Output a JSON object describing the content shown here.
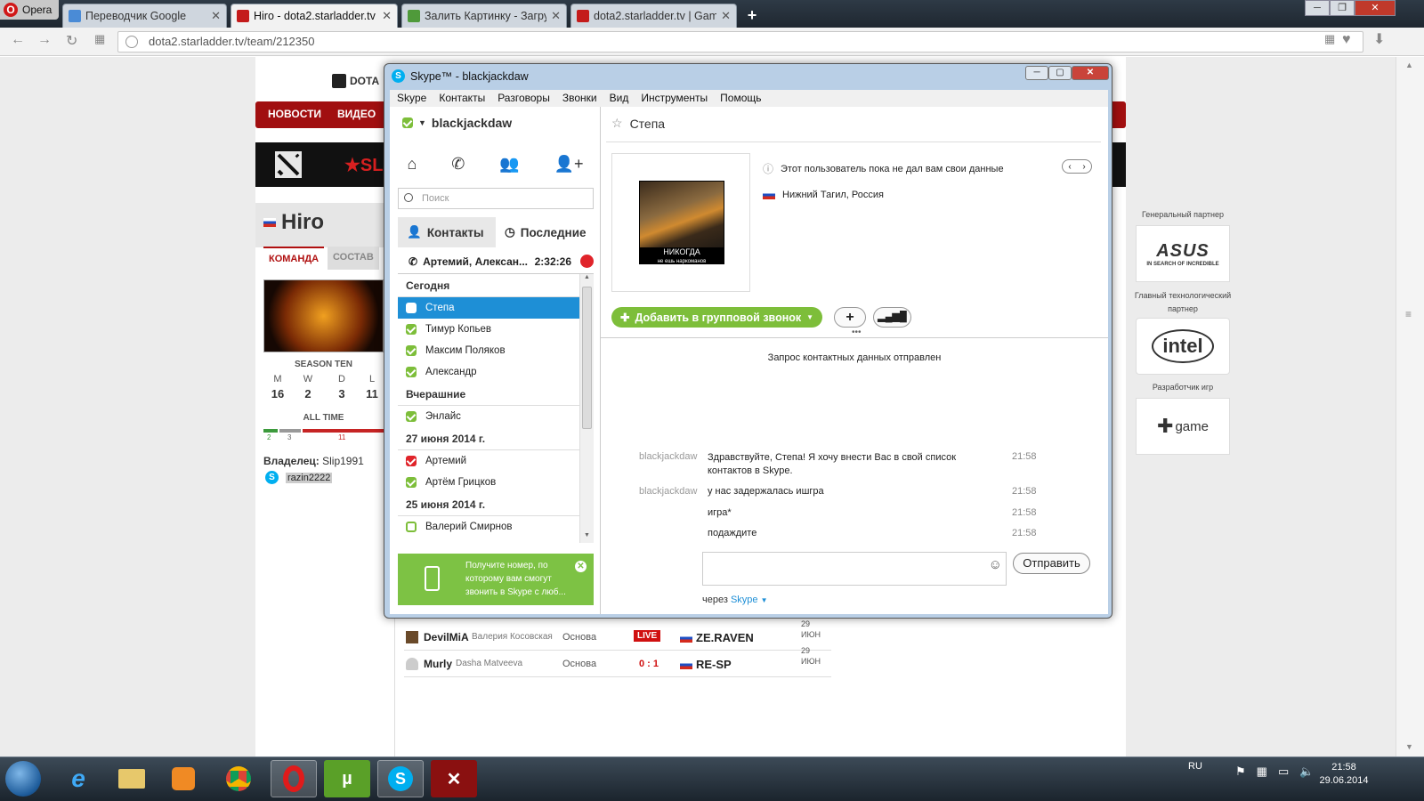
{
  "browser": {
    "opera_label": "Opera",
    "tabs": [
      {
        "title": "Переводчик Google",
        "favicon_color": "#4a8bd6"
      },
      {
        "title": "Hiro - dota2.starladder.tv",
        "favicon_color": "#c41b1b"
      },
      {
        "title": "Залить Картинку - Загруз",
        "favicon_color": "#4f9a3a"
      },
      {
        "title": "dota2.starladder.tv | Game",
        "favicon_color": "#c41b1b"
      }
    ],
    "new_tab_label": "+",
    "url": "dota2.starladder.tv/team/212350"
  },
  "site": {
    "logo_text": "DOTA",
    "nav": [
      "НОВОСТИ",
      "ВИДЕО"
    ],
    "team_name": "Hiro",
    "profile_tabs": [
      "КОМАНДА",
      "СОСТАВ"
    ],
    "season_label": "SEASON TEN",
    "stats": [
      {
        "label": "M",
        "value": "16"
      },
      {
        "label": "W",
        "value": "2"
      },
      {
        "label": "D",
        "value": "3"
      },
      {
        "label": "L",
        "value": "11"
      }
    ],
    "alltime_label": "ALL TIME",
    "alltime_values": [
      "2",
      "3",
      "11"
    ],
    "owner_label": "Владелец:",
    "owner_name": "Slip1991",
    "skype_name": "razin2222",
    "matches": [
      {
        "player": "DevilMiA",
        "real_name": "Валерия Косовская",
        "role": "Основа",
        "score": "LIVE",
        "opponent": "ZE.RAVEN",
        "date_day": "29",
        "date_mon": "ИЮН"
      },
      {
        "player": "Murly",
        "real_name": "Dasha Matveeva",
        "role": "Основа",
        "score": "0 : 1",
        "opponent": "RE-SP",
        "date_day": "29",
        "date_mon": "ИЮН"
      }
    ],
    "sponsors": {
      "general_label": "Генеральный партнер",
      "general_name": "ASUS",
      "general_tagline": "IN SEARCH OF INCREDIBLE",
      "tech_label": "Главный технологический партнер",
      "tech_name": "intel",
      "dev_label": "Разработчик игр",
      "dev_name": "game"
    }
  },
  "skype": {
    "title": "Skype™ - blackjackdaw",
    "menu": [
      "Skype",
      "Контакты",
      "Разговоры",
      "Звонки",
      "Вид",
      "Инструменты",
      "Помощь"
    ],
    "username": "blackjackdaw",
    "search_placeholder": "Поиск",
    "tabs": [
      "Контакты",
      "Последние"
    ],
    "active_call": {
      "name": "Артемий, Алексан...",
      "duration": "2:32:26"
    },
    "groups": [
      {
        "label": "Сегодня",
        "items": [
          {
            "name": "Степа",
            "status": "online",
            "selected": true
          },
          {
            "name": "Тимур Копьев",
            "status": "online",
            "selected": false
          },
          {
            "name": "Максим Поляков",
            "status": "online",
            "selected": false
          },
          {
            "name": "Александр",
            "status": "online",
            "selected": false
          }
        ]
      },
      {
        "label": "Вчерашние",
        "items": [
          {
            "name": "Энлайс",
            "status": "online",
            "selected": false
          }
        ]
      },
      {
        "label": "27 июня 2014 г.",
        "items": [
          {
            "name": "Артемий",
            "status": "busy",
            "selected": false
          },
          {
            "name": "Артём Грицков",
            "status": "online",
            "selected": false
          }
        ]
      },
      {
        "label": "25 июня 2014 г.",
        "items": [
          {
            "name": "Валерий Смирнов",
            "status": "offline",
            "selected": false
          }
        ]
      }
    ],
    "promo_text": "Получите номер, по которому вам смогут звонить в Skype с люб...",
    "contact": {
      "name": "Степа",
      "info_notice": "Этот пользователь пока не дал вам свои данные",
      "location": "Нижний Тагил, Россия",
      "avatar_caption_top": "НИКОГДА",
      "avatar_caption_bottom": "не ешь наркоманов",
      "add_call_label": "Добавить в групповой звонок",
      "add_label": "+"
    },
    "notice": "Запрос контактных данных отправлен",
    "messages": [
      {
        "sender": "blackjackdaw",
        "text": "Здравствуйте, Степа! Я хочу внести Вас в свой список контактов в Skype.",
        "time": "21:58"
      },
      {
        "sender": "blackjackdaw",
        "text": "у нас задержалась ишгра",
        "time": "21:58"
      },
      {
        "sender": "",
        "text": "игра*",
        "time": "21:58"
      },
      {
        "sender": "",
        "text": "подаждите",
        "time": "21:58"
      }
    ],
    "send_label": "Отправить",
    "via_label": "через",
    "via_service": "Skype"
  },
  "taskbar": {
    "lang": "RU",
    "time": "21:58",
    "date": "29.06.2014"
  },
  "colors": {
    "skype_blue": "#00aff0",
    "skype_green": "#7dbe3a",
    "site_red": "#a10f10",
    "select_blue": "#1e8fd6"
  }
}
